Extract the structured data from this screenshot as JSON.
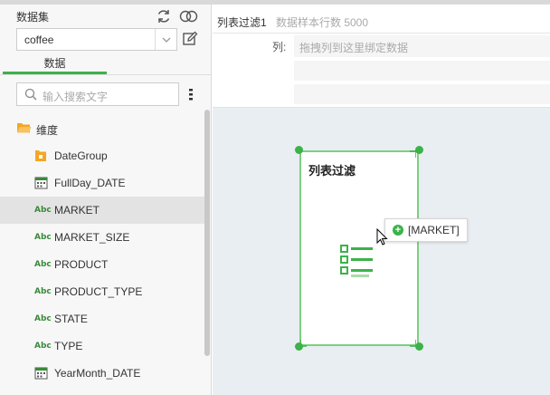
{
  "dataset": {
    "title": "数据集",
    "selected": "coffee",
    "tab_label": "数据",
    "search_placeholder": "输入搜索文字"
  },
  "tree": {
    "folder_label": "维度",
    "items": [
      {
        "label": "DateGroup",
        "type": "group-icon"
      },
      {
        "label": "FullDay_DATE",
        "type": "calendar-icon"
      },
      {
        "label": "MARKET",
        "type": "abc",
        "selected": true
      },
      {
        "label": "MARKET_SIZE",
        "type": "abc"
      },
      {
        "label": "PRODUCT",
        "type": "abc"
      },
      {
        "label": "PRODUCT_TYPE",
        "type": "abc"
      },
      {
        "label": "STATE",
        "type": "abc"
      },
      {
        "label": "TYPE",
        "type": "abc"
      },
      {
        "label": "YearMonth_DATE",
        "type": "calendar-icon"
      }
    ],
    "abc_text": "Abc"
  },
  "editor": {
    "title": "列表过滤1",
    "sample_rows": "数据样本行数 5000",
    "column_label": "列:",
    "drop_placeholder": "拖拽列到这里绑定数据"
  },
  "widget": {
    "title": "列表过滤"
  },
  "drag": {
    "label": "[MARKET]"
  },
  "colors": {
    "accent": "#3cb24a",
    "canvas": "#e9eef2",
    "folder": "#f5a623"
  }
}
